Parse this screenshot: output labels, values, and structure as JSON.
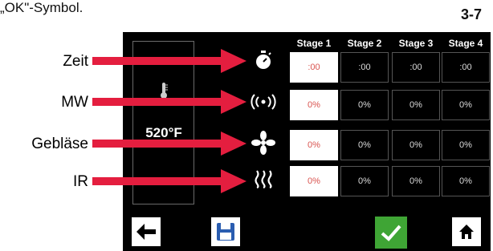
{
  "caption": "„OK\"-Symbol.",
  "page_number": "3-7",
  "temperature": "520°F",
  "stages": [
    "Stage 1",
    "Stage 2",
    "Stage 3",
    "Stage 4"
  ],
  "rows": [
    {
      "label": "Zeit",
      "icon": "stopwatch-icon",
      "values": [
        ":00",
        ":00",
        ":00",
        ":00"
      ]
    },
    {
      "label": "MW",
      "icon": "microwave-signal-icon",
      "values": [
        "0%",
        "0%",
        "0%",
        "0%"
      ]
    },
    {
      "label": "Gebläse",
      "icon": "fan-icon",
      "values": [
        "0%",
        "0%",
        "0%",
        "0%"
      ]
    },
    {
      "label": "IR",
      "icon": "infrared-heat-icon",
      "values": [
        "0%",
        "0%",
        "0%",
        "0%"
      ]
    }
  ],
  "colors": {
    "arrow": "#e41e3f",
    "accent_active": "#d9534f",
    "ok_green": "#3fa535",
    "save_blue": "#2a5db0"
  }
}
